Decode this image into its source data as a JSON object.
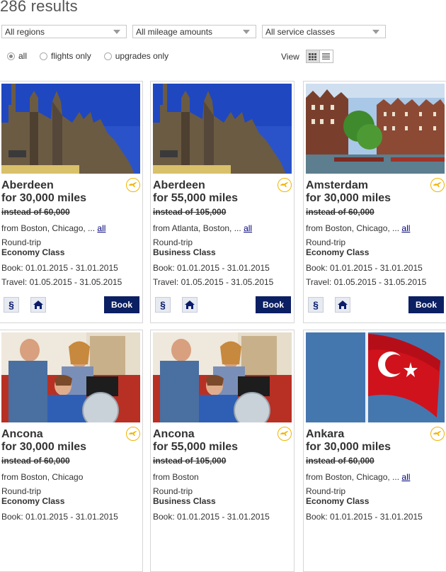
{
  "results_count": "286 results",
  "filters": {
    "region": "All regions",
    "mileage": "All mileage amounts",
    "service": "All service classes"
  },
  "radios": {
    "all": "all",
    "flights": "flights only",
    "upgrades": "upgrades only"
  },
  "view_label": "View",
  "cards": [
    {
      "city": "Aberdeen",
      "miles": "for 30,000 miles",
      "instead": "instead of 60,000",
      "from": "from Boston, Chicago, ...",
      "all_link": "all",
      "trip": "Round-trip",
      "cls": "Economy Class",
      "book": "Book: 01.01.2015 - 31.01.2015",
      "travel": "Travel: 01.05.2015 - 31.05.2015",
      "book_btn": "Book",
      "icon_1": "§"
    },
    {
      "city": "Aberdeen",
      "miles": "for 55,000 miles",
      "instead": "instead of 105,000",
      "from": "from Atlanta, Boston, ...",
      "all_link": "all",
      "trip": "Round-trip",
      "cls": "Business Class",
      "book": "Book: 01.01.2015 - 31.01.2015",
      "travel": "Travel: 01.05.2015 - 31.05.2015",
      "book_btn": "Book",
      "icon_1": "§"
    },
    {
      "city": "Amsterdam",
      "miles": "for 30,000 miles",
      "instead": "instead of 60,000",
      "from": "from Boston, Chicago, ...",
      "all_link": "all",
      "trip": "Round-trip",
      "cls": "Economy Class",
      "book": "Book: 01.01.2015 - 31.01.2015",
      "travel": "Travel: 01.05.2015 - 31.05.2015",
      "book_btn": "Book",
      "icon_1": "§"
    },
    {
      "city": "Ancona",
      "miles": "for 30,000 miles",
      "instead": "instead of 60,000",
      "from": "from Boston, Chicago",
      "all_link": "",
      "trip": "Round-trip",
      "cls": "Economy Class",
      "book": "Book: 01.01.2015 - 31.01.2015",
      "travel": "",
      "book_btn": "",
      "icon_1": ""
    },
    {
      "city": "Ancona",
      "miles": "for 55,000 miles",
      "instead": "instead of 105,000",
      "from": "from Boston",
      "all_link": "",
      "trip": "Round-trip",
      "cls": "Business Class",
      "book": "Book: 01.01.2015 - 31.01.2015",
      "travel": "",
      "book_btn": "",
      "icon_1": ""
    },
    {
      "city": "Ankara",
      "miles": "for 30,000 miles",
      "instead": "instead of 60,000",
      "from": "from Boston, Chicago, ...",
      "all_link": "all",
      "trip": "Round-trip",
      "cls": "Economy Class",
      "book": "Book: 01.01.2015 - 31.01.2015",
      "travel": "",
      "book_btn": "",
      "icon_1": ""
    }
  ]
}
